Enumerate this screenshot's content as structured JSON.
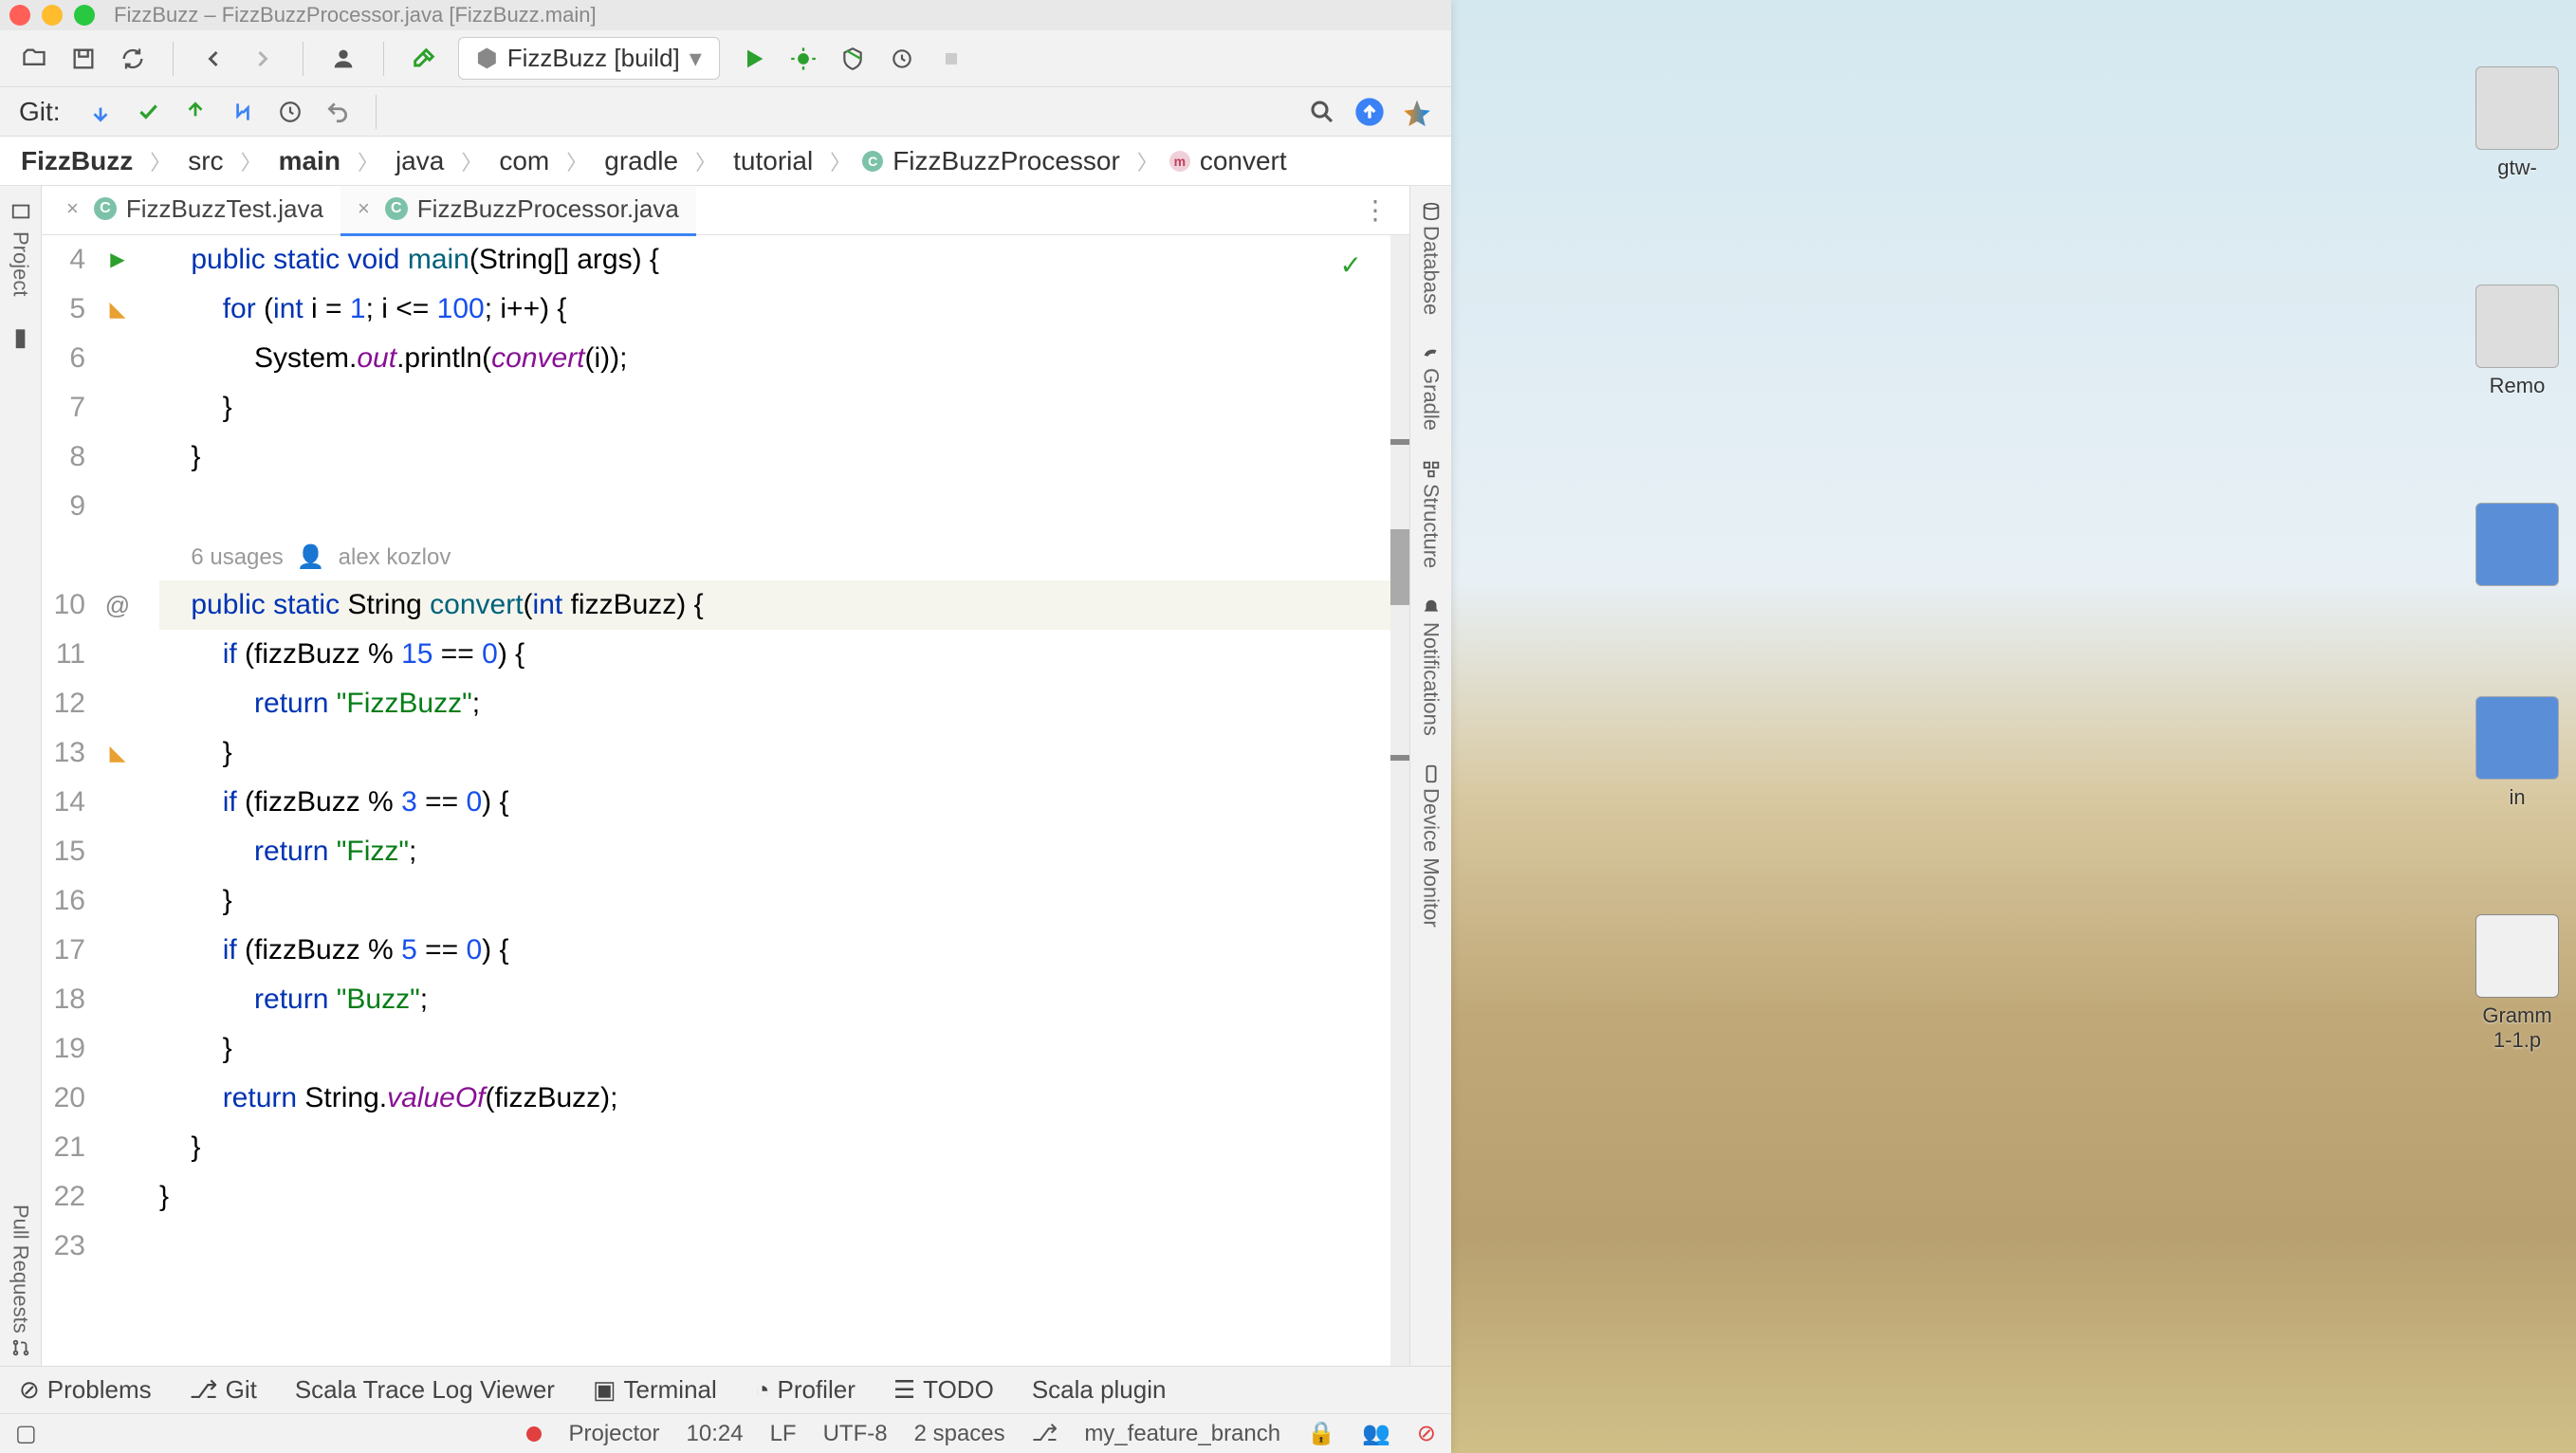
{
  "window_title": "FizzBuzz – FizzBuzzProcessor.java [FizzBuzz.main]",
  "run_config": "FizzBuzz [build]",
  "git_label": "Git:",
  "breadcrumb": [
    "FizzBuzz",
    "src",
    "main",
    "java",
    "com",
    "gradle",
    "tutorial",
    "FizzBuzzProcessor",
    "convert"
  ],
  "tabs": [
    {
      "label": "FizzBuzzTest.java",
      "active": false
    },
    {
      "label": "FizzBuzzProcessor.java",
      "active": true
    }
  ],
  "left_tools": [
    "Project",
    "Pull Requests"
  ],
  "right_tools": [
    "Database",
    "Gradle",
    "Structure",
    "Notifications",
    "Device Monitor"
  ],
  "bottom_tools": [
    "Problems",
    "Git",
    "Scala Trace Log Viewer",
    "Terminal",
    "Profiler",
    "TODO",
    "Scala plugin"
  ],
  "status": {
    "projector": "Projector",
    "cursor": "10:24",
    "lf": "LF",
    "enc": "UTF-8",
    "indent": "2 spaces",
    "branch": "my_feature_branch"
  },
  "code": {
    "lines": [
      4,
      5,
      6,
      7,
      8,
      9,
      "",
      10,
      11,
      12,
      13,
      14,
      15,
      16,
      17,
      18,
      19,
      20,
      21,
      22,
      23
    ],
    "hint_usages": "6 usages",
    "hint_author": "alex kozlov",
    "l4": "public static void main(String[] args) {",
    "l5": "for (int i = 1; i <= 100; i++) {",
    "l6": "System.out.println(convert(i));",
    "l7": "}",
    "l8": "}",
    "l10": "public static String convert(int fizzBuzz) {",
    "l11": "if (fizzBuzz % 15 == 0) {",
    "l12": "return \"FizzBuzz\";",
    "l13": "}",
    "l14": "if (fizzBuzz % 3 == 0) {",
    "l15": "return \"Fizz\";",
    "l16": "}",
    "l17": "if (fizzBuzz % 5 == 0) {",
    "l18": "return \"Buzz\";",
    "l19": "}",
    "l20": "return String.valueOf(fizzBuzz);",
    "l21": "}",
    "l22": "}"
  },
  "desktop": [
    "gtw-",
    "Remo",
    "",
    "in",
    "Gramm",
    "1-1.p"
  ]
}
